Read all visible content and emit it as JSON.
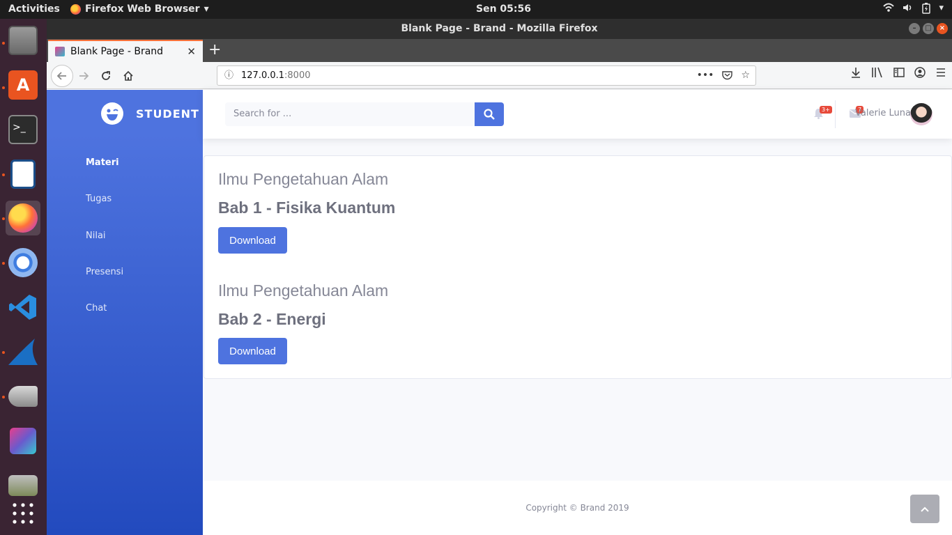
{
  "system": {
    "activities": "Activities",
    "app_menu": "Firefox Web Browser",
    "clock": "Sen 05:56"
  },
  "window": {
    "title": "Blank Page - Brand - Mozilla Firefox"
  },
  "browser": {
    "tab_title": "Blank Page - Brand",
    "url_host": "127.0.0.1",
    "url_port": ":8000"
  },
  "app": {
    "brand": "STUDENT",
    "sidebar": {
      "items": [
        {
          "label": "Materi",
          "active": true
        },
        {
          "label": "Tugas"
        },
        {
          "label": "Nilai"
        },
        {
          "label": "Presensi"
        },
        {
          "label": "Chat"
        }
      ]
    },
    "search": {
      "placeholder": "Search for ..."
    },
    "alerts": {
      "notifications_count": "3+",
      "messages_count": "7"
    },
    "user": {
      "name": "Valerie Luna"
    },
    "materials": [
      {
        "subject": "Ilmu Pengetahuan Alam",
        "chapter": "Bab 1 - Fisika Kuantum",
        "button": "Download"
      },
      {
        "subject": "Ilmu Pengetahuan Alam",
        "chapter": "Bab 2 - Energi",
        "button": "Download"
      }
    ],
    "footer": {
      "copyright": "Copyright © Brand 2019"
    }
  },
  "colors": {
    "primary": "#4e73df",
    "sidebar_end": "#224abe",
    "danger": "#e74a3b",
    "text_muted": "#858796",
    "dock_bg": "#3a2433"
  },
  "icons": [
    "firefox-icon",
    "wifi-icon",
    "volume-icon",
    "battery-icon",
    "search-icon",
    "bell-icon",
    "envelope-icon",
    "chevron-up-icon",
    "home-icon",
    "reload-icon",
    "back-icon",
    "forward-icon"
  ]
}
